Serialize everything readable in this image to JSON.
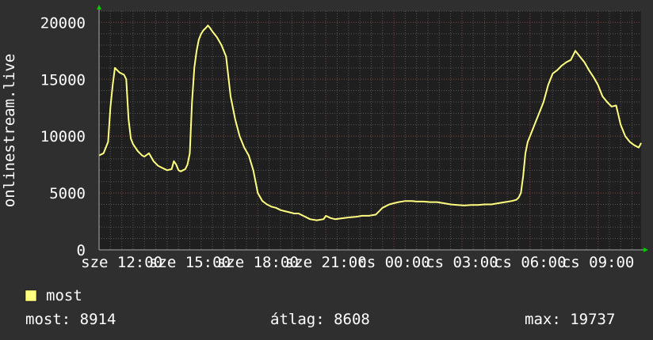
{
  "colors": {
    "background": "#2f2f2f",
    "plot_background": "#1f1f1f",
    "grid_minor": "#575757",
    "grid_major": "#7a3b3b",
    "series": "#ffff80",
    "axis_arrow": "#00cc00",
    "text": "#ffffff"
  },
  "legend": {
    "label": "most"
  },
  "stats": {
    "current": "most: 8914",
    "average": "átlag: 8608",
    "max": "max: 19737"
  },
  "chart_data": {
    "type": "line",
    "ylabel": "onlinestream.live",
    "ylim": [
      0,
      21000
    ],
    "ytick_labels": [
      "0",
      "5000",
      "10000",
      "15000",
      "20000"
    ],
    "yticks": [
      0,
      5000,
      10000,
      15000,
      20000
    ],
    "x_range_hours": [
      11.0,
      34.9
    ],
    "xtick_positions_hours": [
      12,
      15,
      18,
      21,
      24,
      27,
      30,
      33
    ],
    "xtick_labels": [
      [
        "sze",
        "12:00"
      ],
      [
        "sze",
        "15:00"
      ],
      [
        "sze",
        "18:00"
      ],
      [
        "sze",
        "21:00"
      ],
      [
        "cs",
        "00:00"
      ],
      [
        "cs",
        "03:00"
      ],
      [
        "cs",
        "06:00"
      ],
      [
        "cs",
        "09:00"
      ]
    ],
    "grid": true,
    "series": [
      {
        "name": "most",
        "color": "#ffff80",
        "x_hours": [
          11.0,
          11.2,
          11.4,
          11.5,
          11.6,
          11.7,
          11.8,
          11.9,
          12.0,
          12.1,
          12.2,
          12.3,
          12.4,
          12.5,
          12.6,
          12.7,
          12.8,
          12.9,
          13.0,
          13.2,
          13.4,
          13.6,
          13.8,
          14.0,
          14.2,
          14.3,
          14.4,
          14.5,
          14.6,
          14.7,
          14.8,
          14.9,
          15.0,
          15.1,
          15.2,
          15.3,
          15.4,
          15.5,
          15.6,
          15.7,
          15.8,
          15.9,
          16.0,
          16.2,
          16.4,
          16.6,
          16.8,
          17.0,
          17.2,
          17.4,
          17.6,
          17.8,
          18.0,
          18.2,
          18.4,
          18.6,
          18.8,
          19.0,
          19.2,
          19.4,
          19.6,
          19.8,
          20.0,
          20.3,
          20.6,
          20.9,
          21.0,
          21.2,
          21.4,
          21.6,
          21.8,
          22.0,
          22.3,
          22.6,
          22.9,
          23.2,
          23.5,
          23.8,
          24.0,
          24.2,
          24.5,
          24.8,
          25.0,
          25.3,
          25.6,
          25.9,
          26.2,
          26.5,
          26.8,
          27.1,
          27.4,
          27.7,
          28.0,
          28.3,
          28.6,
          28.9,
          29.2,
          29.4,
          29.5,
          29.6,
          29.7,
          29.8,
          29.9,
          30.0,
          30.2,
          30.4,
          30.6,
          30.8,
          31.0,
          31.2,
          31.4,
          31.6,
          31.8,
          32.0,
          32.2,
          32.4,
          32.6,
          32.8,
          33.0,
          33.2,
          33.4,
          33.6,
          33.8,
          34.0,
          34.2,
          34.4,
          34.6,
          34.8,
          34.9
        ],
        "values": [
          8300,
          8500,
          9500,
          12500,
          14500,
          16000,
          15800,
          15600,
          15500,
          15400,
          15000,
          11500,
          9800,
          9300,
          9000,
          8700,
          8500,
          8300,
          8200,
          8500,
          7800,
          7400,
          7200,
          7000,
          7100,
          7800,
          7500,
          7000,
          6900,
          7000,
          7100,
          7500,
          8500,
          13000,
          16000,
          17500,
          18500,
          19000,
          19300,
          19500,
          19737,
          19500,
          19200,
          18700,
          18000,
          17000,
          13500,
          11500,
          10000,
          9000,
          8300,
          7000,
          5000,
          4300,
          4000,
          3800,
          3700,
          3500,
          3400,
          3300,
          3200,
          3200,
          3000,
          2700,
          2600,
          2700,
          3000,
          2800,
          2700,
          2750,
          2800,
          2850,
          2900,
          3000,
          3000,
          3100,
          3700,
          4000,
          4100,
          4200,
          4300,
          4300,
          4250,
          4250,
          4200,
          4200,
          4100,
          4000,
          3950,
          3900,
          3950,
          3950,
          4000,
          4000,
          4100,
          4200,
          4300,
          4400,
          4600,
          5000,
          6500,
          8500,
          9500,
          10000,
          11000,
          12000,
          13000,
          14500,
          15500,
          15800,
          16200,
          16500,
          16700,
          17500,
          17000,
          16500,
          15800,
          15200,
          14500,
          13500,
          13000,
          12600,
          12700,
          11000,
          10000,
          9500,
          9200,
          9000,
          9400,
          8900
        ]
      }
    ]
  }
}
